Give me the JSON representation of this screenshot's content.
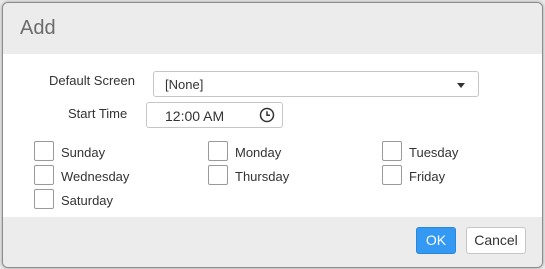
{
  "dialog": {
    "title": "Add",
    "default_screen_label": "Default Screen",
    "default_screen_value": "[None]",
    "start_time_label": "Start Time",
    "start_time_value": "12:00 AM",
    "days": [
      {
        "label": "Sunday",
        "checked": false
      },
      {
        "label": "Monday",
        "checked": false
      },
      {
        "label": "Tuesday",
        "checked": false
      },
      {
        "label": "Wednesday",
        "checked": false
      },
      {
        "label": "Thursday",
        "checked": false
      },
      {
        "label": "Friday",
        "checked": false
      },
      {
        "label": "Saturday",
        "checked": false
      }
    ],
    "ok_label": "OK",
    "cancel_label": "Cancel"
  },
  "colors": {
    "primary_button": "#3399f3",
    "header_background": "#ececec"
  }
}
